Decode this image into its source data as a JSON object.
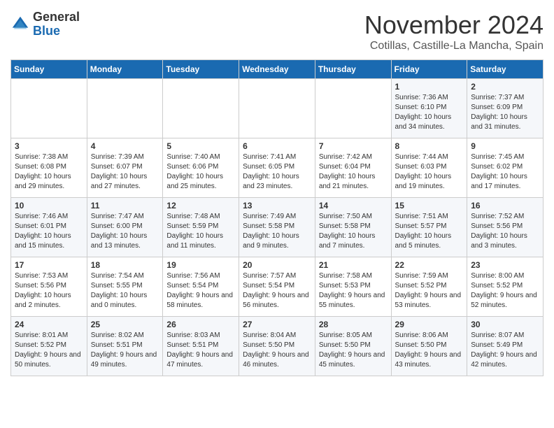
{
  "header": {
    "logo_line1": "General",
    "logo_line2": "Blue",
    "month": "November 2024",
    "location": "Cotillas, Castille-La Mancha, Spain"
  },
  "days_of_week": [
    "Sunday",
    "Monday",
    "Tuesday",
    "Wednesday",
    "Thursday",
    "Friday",
    "Saturday"
  ],
  "weeks": [
    [
      {
        "day": "",
        "info": ""
      },
      {
        "day": "",
        "info": ""
      },
      {
        "day": "",
        "info": ""
      },
      {
        "day": "",
        "info": ""
      },
      {
        "day": "",
        "info": ""
      },
      {
        "day": "1",
        "info": "Sunrise: 7:36 AM\nSunset: 6:10 PM\nDaylight: 10 hours and 34 minutes."
      },
      {
        "day": "2",
        "info": "Sunrise: 7:37 AM\nSunset: 6:09 PM\nDaylight: 10 hours and 31 minutes."
      }
    ],
    [
      {
        "day": "3",
        "info": "Sunrise: 7:38 AM\nSunset: 6:08 PM\nDaylight: 10 hours and 29 minutes."
      },
      {
        "day": "4",
        "info": "Sunrise: 7:39 AM\nSunset: 6:07 PM\nDaylight: 10 hours and 27 minutes."
      },
      {
        "day": "5",
        "info": "Sunrise: 7:40 AM\nSunset: 6:06 PM\nDaylight: 10 hours and 25 minutes."
      },
      {
        "day": "6",
        "info": "Sunrise: 7:41 AM\nSunset: 6:05 PM\nDaylight: 10 hours and 23 minutes."
      },
      {
        "day": "7",
        "info": "Sunrise: 7:42 AM\nSunset: 6:04 PM\nDaylight: 10 hours and 21 minutes."
      },
      {
        "day": "8",
        "info": "Sunrise: 7:44 AM\nSunset: 6:03 PM\nDaylight: 10 hours and 19 minutes."
      },
      {
        "day": "9",
        "info": "Sunrise: 7:45 AM\nSunset: 6:02 PM\nDaylight: 10 hours and 17 minutes."
      }
    ],
    [
      {
        "day": "10",
        "info": "Sunrise: 7:46 AM\nSunset: 6:01 PM\nDaylight: 10 hours and 15 minutes."
      },
      {
        "day": "11",
        "info": "Sunrise: 7:47 AM\nSunset: 6:00 PM\nDaylight: 10 hours and 13 minutes."
      },
      {
        "day": "12",
        "info": "Sunrise: 7:48 AM\nSunset: 5:59 PM\nDaylight: 10 hours and 11 minutes."
      },
      {
        "day": "13",
        "info": "Sunrise: 7:49 AM\nSunset: 5:58 PM\nDaylight: 10 hours and 9 minutes."
      },
      {
        "day": "14",
        "info": "Sunrise: 7:50 AM\nSunset: 5:58 PM\nDaylight: 10 hours and 7 minutes."
      },
      {
        "day": "15",
        "info": "Sunrise: 7:51 AM\nSunset: 5:57 PM\nDaylight: 10 hours and 5 minutes."
      },
      {
        "day": "16",
        "info": "Sunrise: 7:52 AM\nSunset: 5:56 PM\nDaylight: 10 hours and 3 minutes."
      }
    ],
    [
      {
        "day": "17",
        "info": "Sunrise: 7:53 AM\nSunset: 5:56 PM\nDaylight: 10 hours and 2 minutes."
      },
      {
        "day": "18",
        "info": "Sunrise: 7:54 AM\nSunset: 5:55 PM\nDaylight: 10 hours and 0 minutes."
      },
      {
        "day": "19",
        "info": "Sunrise: 7:56 AM\nSunset: 5:54 PM\nDaylight: 9 hours and 58 minutes."
      },
      {
        "day": "20",
        "info": "Sunrise: 7:57 AM\nSunset: 5:54 PM\nDaylight: 9 hours and 56 minutes."
      },
      {
        "day": "21",
        "info": "Sunrise: 7:58 AM\nSunset: 5:53 PM\nDaylight: 9 hours and 55 minutes."
      },
      {
        "day": "22",
        "info": "Sunrise: 7:59 AM\nSunset: 5:52 PM\nDaylight: 9 hours and 53 minutes."
      },
      {
        "day": "23",
        "info": "Sunrise: 8:00 AM\nSunset: 5:52 PM\nDaylight: 9 hours and 52 minutes."
      }
    ],
    [
      {
        "day": "24",
        "info": "Sunrise: 8:01 AM\nSunset: 5:52 PM\nDaylight: 9 hours and 50 minutes."
      },
      {
        "day": "25",
        "info": "Sunrise: 8:02 AM\nSunset: 5:51 PM\nDaylight: 9 hours and 49 minutes."
      },
      {
        "day": "26",
        "info": "Sunrise: 8:03 AM\nSunset: 5:51 PM\nDaylight: 9 hours and 47 minutes."
      },
      {
        "day": "27",
        "info": "Sunrise: 8:04 AM\nSunset: 5:50 PM\nDaylight: 9 hours and 46 minutes."
      },
      {
        "day": "28",
        "info": "Sunrise: 8:05 AM\nSunset: 5:50 PM\nDaylight: 9 hours and 45 minutes."
      },
      {
        "day": "29",
        "info": "Sunrise: 8:06 AM\nSunset: 5:50 PM\nDaylight: 9 hours and 43 minutes."
      },
      {
        "day": "30",
        "info": "Sunrise: 8:07 AM\nSunset: 5:49 PM\nDaylight: 9 hours and 42 minutes."
      }
    ]
  ]
}
